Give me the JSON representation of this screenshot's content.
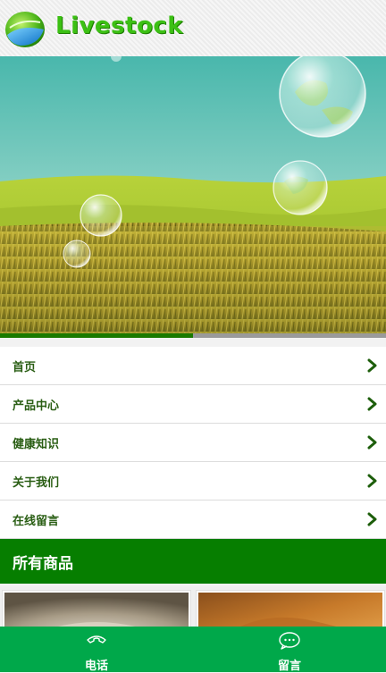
{
  "header": {
    "logo_text": "Livestock"
  },
  "banner": {
    "progress": 0.5
  },
  "menu": {
    "items": [
      {
        "label": "首页"
      },
      {
        "label": "产品中心"
      },
      {
        "label": "健康知识"
      },
      {
        "label": "关于我们"
      },
      {
        "label": "在线留言"
      }
    ]
  },
  "section": {
    "title": "所有商品"
  },
  "bottom_bar": {
    "phone_label": "电话",
    "message_label": "留言"
  },
  "colors": {
    "brand_green": "#067e00",
    "bottom_bar": "#00a84a",
    "menu_text": "#2a5e14",
    "logo_text": "#3cc014"
  },
  "icons": {
    "logo": "leaf-globe-icon",
    "menu_chevron": "chevron-right-icon",
    "phone": "phone-icon",
    "message": "chat-bubble-icon"
  }
}
